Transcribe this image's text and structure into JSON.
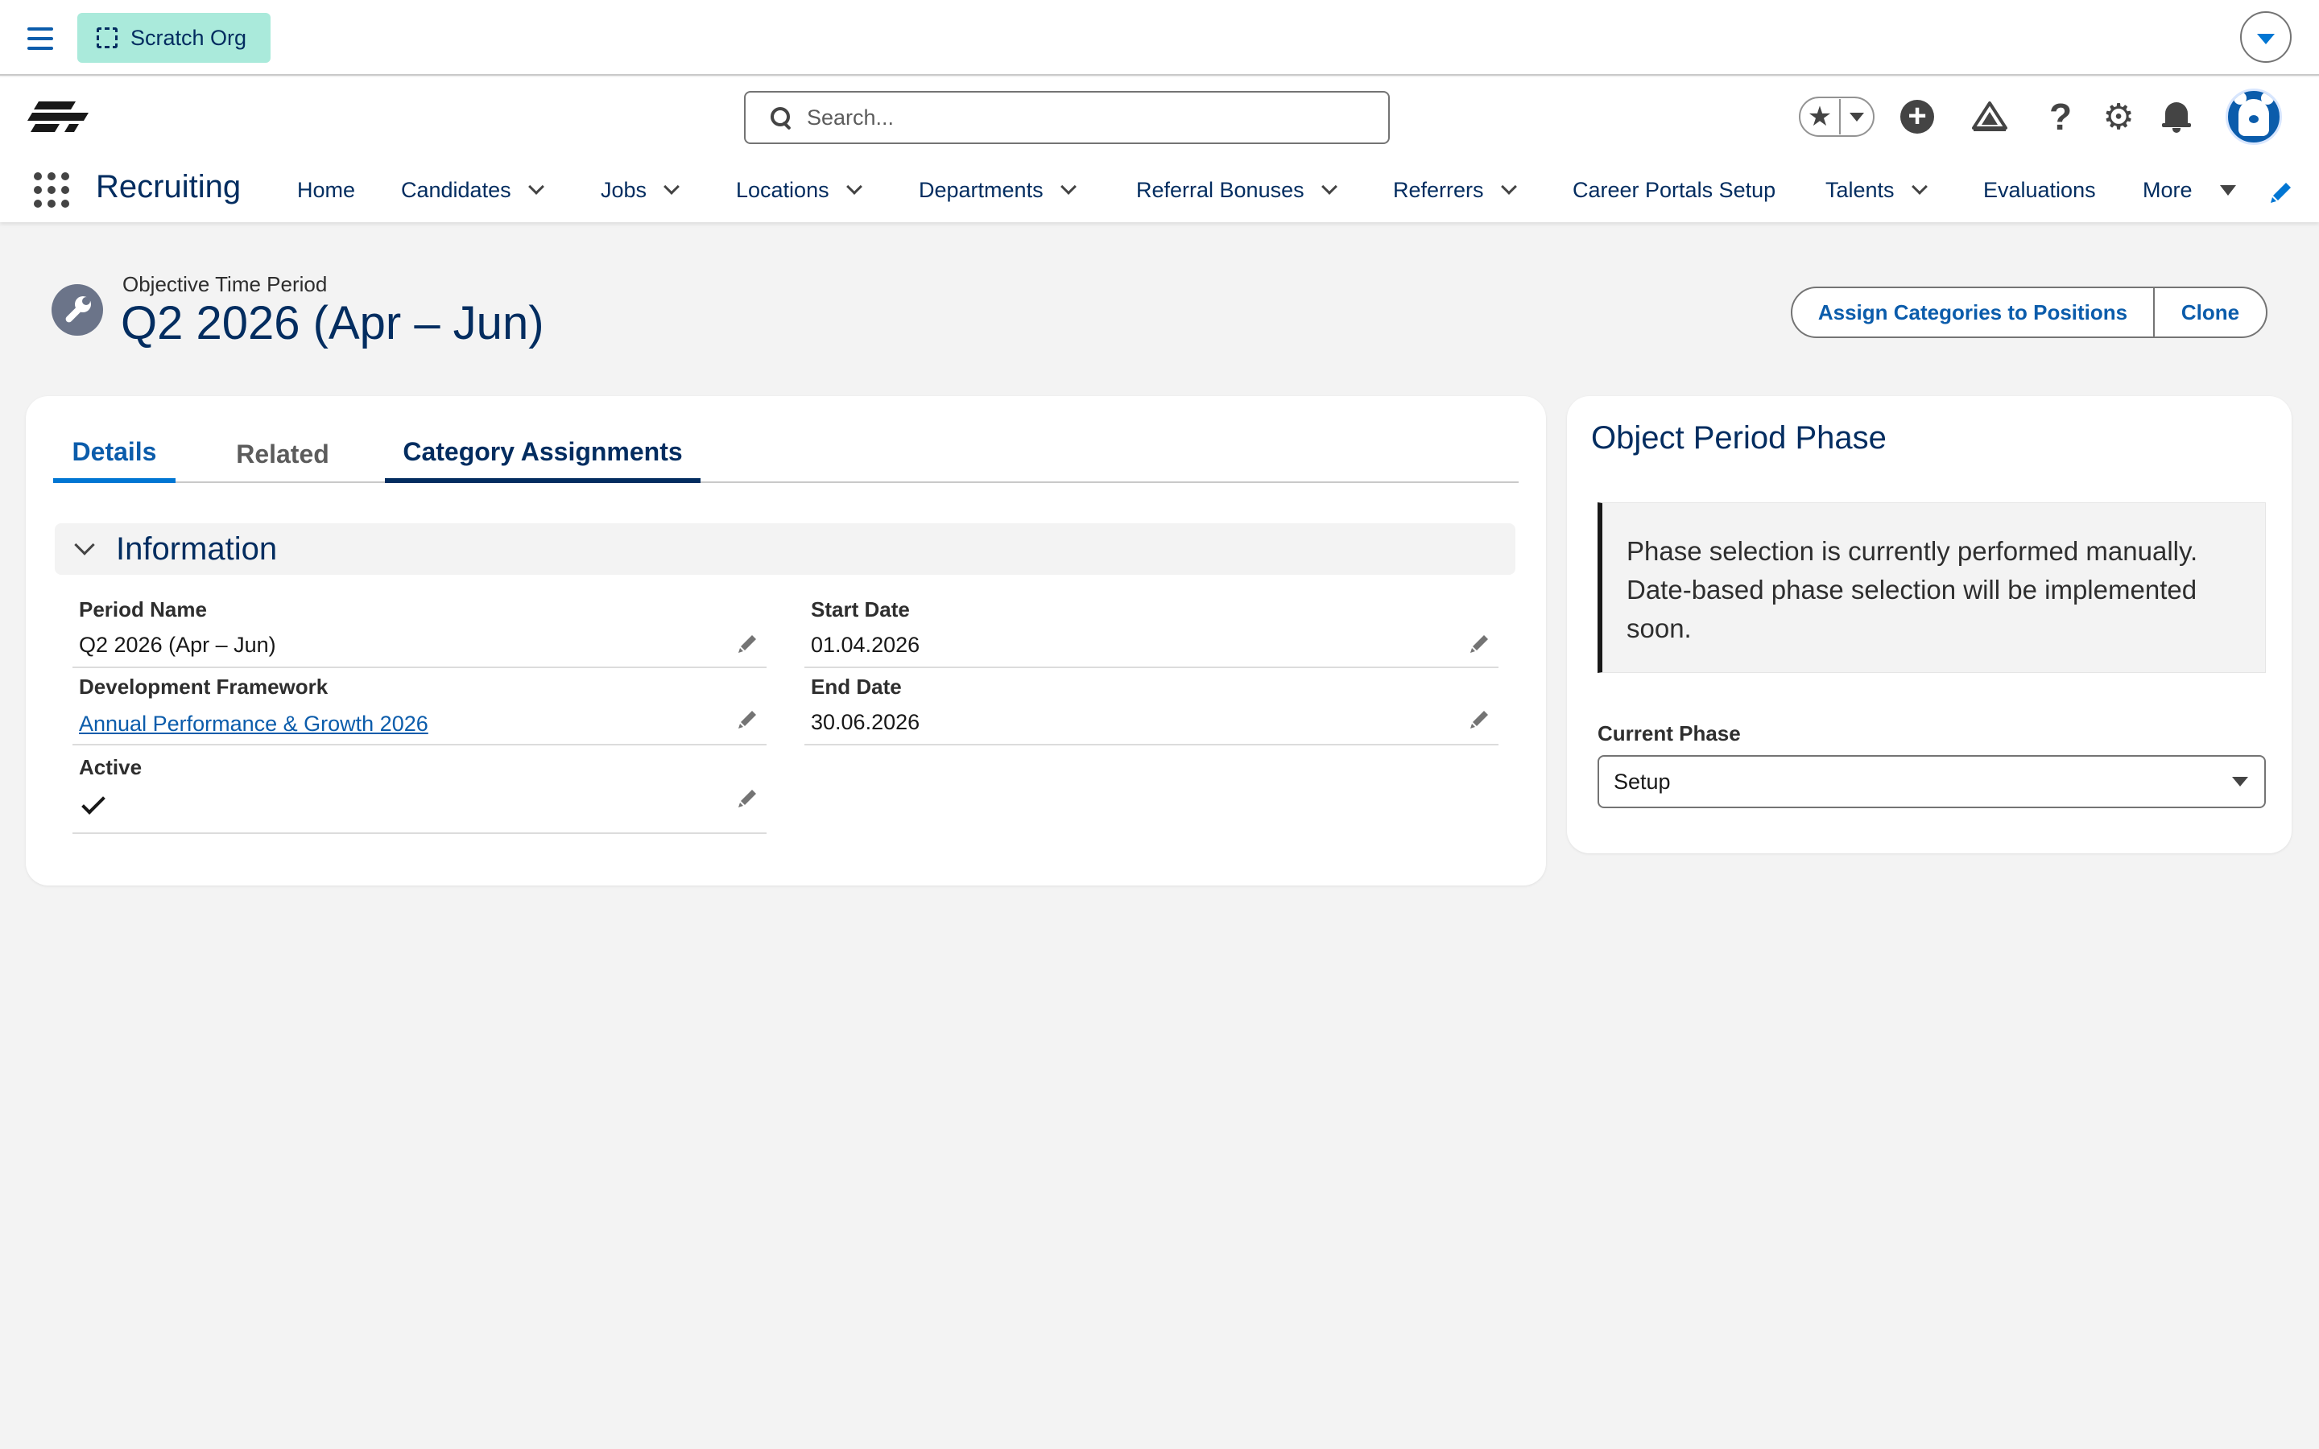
{
  "org": {
    "badge_label": "Scratch Org"
  },
  "header": {
    "search_placeholder": "Search..."
  },
  "app": {
    "name": "Recruiting",
    "nav": [
      {
        "label": "Home"
      },
      {
        "label": "Candidates"
      },
      {
        "label": "Jobs"
      },
      {
        "label": "Locations"
      },
      {
        "label": "Departments"
      },
      {
        "label": "Referral Bonuses"
      },
      {
        "label": "Referrers"
      },
      {
        "label": "Career Portals Setup"
      },
      {
        "label": "Talents"
      },
      {
        "label": "Evaluations"
      },
      {
        "label": "More"
      }
    ]
  },
  "record": {
    "type_label": "Objective Time Period",
    "title": "Q2 2026 (Apr – Jun)",
    "actions": {
      "assign": "Assign Categories to Positions",
      "clone": "Clone"
    }
  },
  "tabs": {
    "details": "Details",
    "related": "Related",
    "category_assignments": "Category Assignments"
  },
  "information": {
    "section_title": "Information",
    "period_name": {
      "label": "Period Name",
      "value": "Q2 2026 (Apr – Jun)"
    },
    "development_framework": {
      "label": "Development Framework",
      "value": "Annual Performance & Growth 2026"
    },
    "active": {
      "label": "Active",
      "checked": true
    },
    "start_date": {
      "label": "Start Date",
      "value": "01.04.2026"
    },
    "end_date": {
      "label": "End Date",
      "value": "30.06.2026"
    }
  },
  "phase_panel": {
    "title": "Object Period Phase",
    "notice": "Phase selection is currently performed manually. Date-based phase selection will be implemented soon.",
    "current_phase_label": "Current Phase",
    "current_phase_value": "Setup"
  },
  "icons": {
    "menu": "hamburger-menu-icon",
    "org": "dashed-square-icon",
    "setup_menu": "chevron-down-icon",
    "search": "search-icon",
    "favorites": "star-icon",
    "new": "plus-icon",
    "trailhead": "trailhead-icon",
    "help": "help-icon",
    "setup": "gear-icon",
    "notifications": "bell-icon",
    "app_launcher": "waffle-icon",
    "record": "wrench-icon",
    "edit": "pencil-icon",
    "check": "checkmark-icon"
  },
  "colors": {
    "brand": "#0176d3",
    "link": "#0b5cab",
    "heading": "#032d60",
    "org_badge": "#aaeadb",
    "record_icon": "#6b7489",
    "page_bg": "#f3f3f3"
  }
}
